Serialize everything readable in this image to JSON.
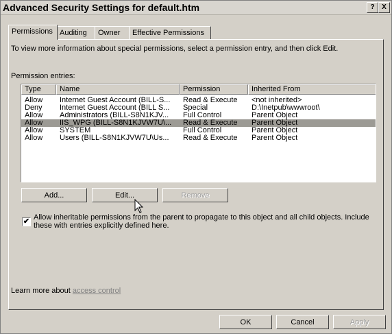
{
  "window": {
    "title": "Advanced Security Settings for default.htm",
    "help_label": "?",
    "close_label": "X"
  },
  "tabs": [
    {
      "label": "Permissions",
      "active": true
    },
    {
      "label": "Auditing",
      "active": false
    },
    {
      "label": "Owner",
      "active": false
    },
    {
      "label": "Effective Permissions",
      "active": false
    }
  ],
  "info_text": "To view more information about special permissions, select a permission entry, and then click Edit.",
  "permission_entries_label": "Permission entries:",
  "table": {
    "columns": [
      "Type",
      "Name",
      "Permission",
      "Inherited From"
    ],
    "rows": [
      {
        "type": "Allow",
        "name": "Internet Guest Account (BILL-S...",
        "permission": "Read & Execute",
        "inherited": "<not inherited>",
        "selected": false
      },
      {
        "type": "Deny",
        "name": "Internet Guest Account (BILL S...",
        "permission": "Special",
        "inherited": "D:\\Inetpub\\wwwroot\\",
        "selected": false
      },
      {
        "type": "Allow",
        "name": "Administrators (BILL-S8N1KJV...",
        "permission": "Full Control",
        "inherited": "Parent Object",
        "selected": false
      },
      {
        "type": "Allow",
        "name": "IIS_WPG (BILL-S8N1KJVW7U\\...",
        "permission": "Read & Execute",
        "inherited": "Parent Object",
        "selected": true
      },
      {
        "type": "Allow",
        "name": "SYSTEM",
        "permission": "Full Control",
        "inherited": "Parent Object",
        "selected": false
      },
      {
        "type": "Allow",
        "name": "Users (BILL-S8N1KJVW7U\\Us...",
        "permission": "Read & Execute",
        "inherited": "Parent Object",
        "selected": false
      }
    ]
  },
  "buttons": {
    "add": "Add...",
    "edit": "Edit...",
    "remove": "Remove",
    "ok": "OK",
    "cancel": "Cancel",
    "apply": "Apply"
  },
  "inherit_checkbox": {
    "checked": true,
    "label": "Allow inheritable permissions from the parent to propagate to this object and all child objects. Include these with entries explicitly defined here."
  },
  "learn_more": {
    "prefix": "Learn more about ",
    "link": "access control"
  }
}
